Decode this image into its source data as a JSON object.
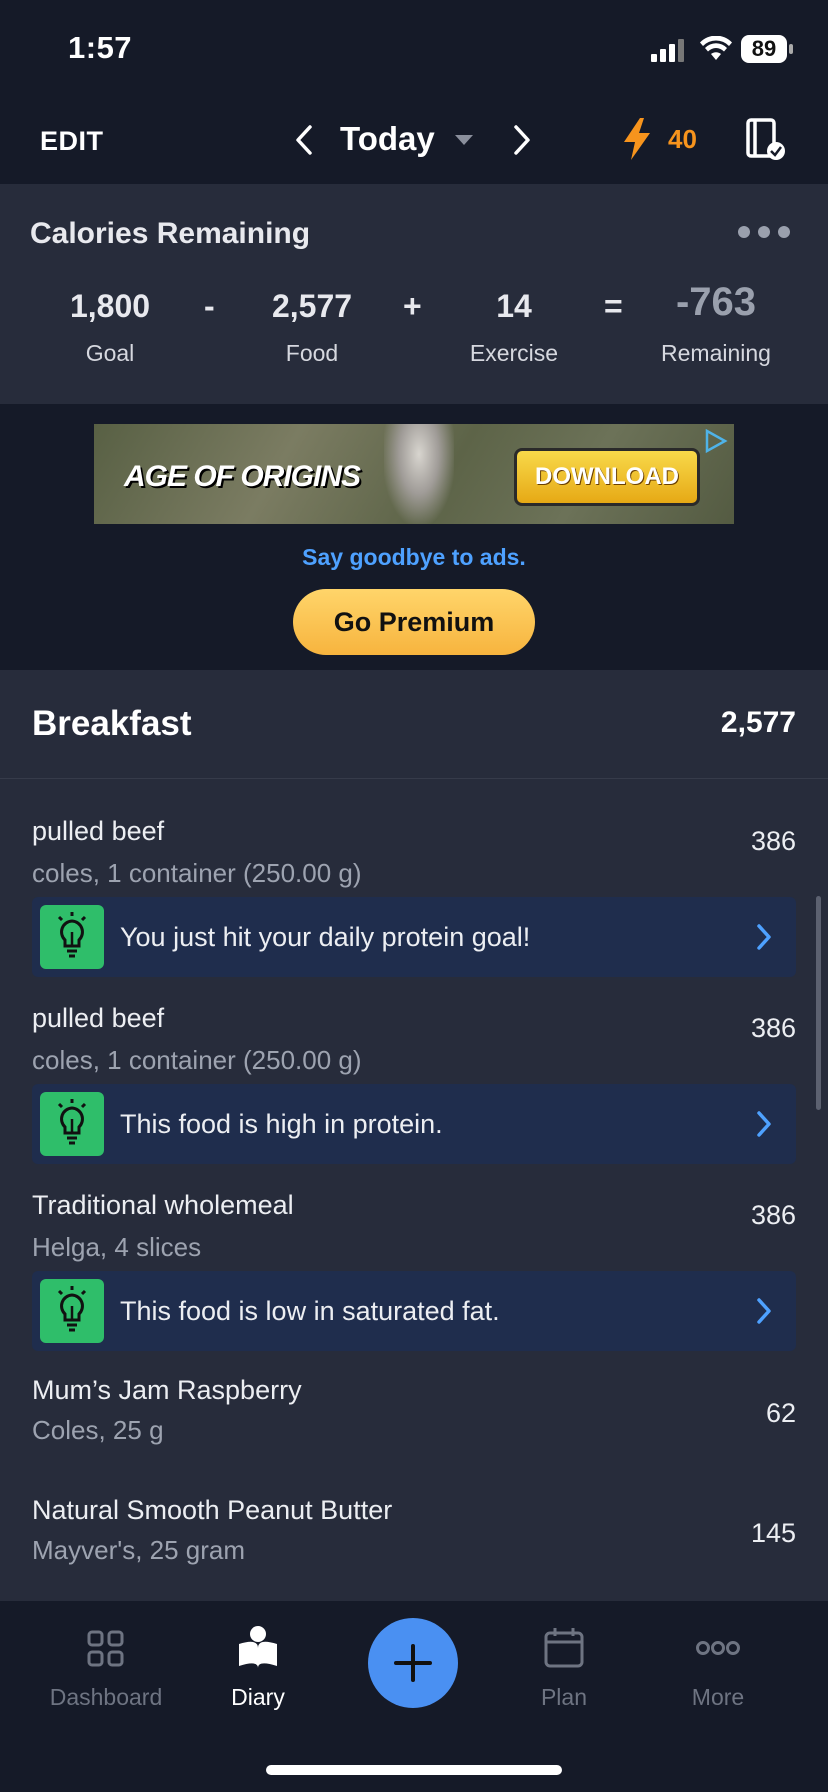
{
  "status_bar": {
    "time": "1:57",
    "battery": "89"
  },
  "header": {
    "edit_label": "EDIT",
    "date_label": "Today",
    "streak_count": "40"
  },
  "calories": {
    "title": "Calories Remaining",
    "goal": {
      "value": "1,800",
      "label": "Goal"
    },
    "food": {
      "value": "2,577",
      "label": "Food"
    },
    "exercise": {
      "value": "14",
      "label": "Exercise"
    },
    "remaining": {
      "value": "-763",
      "label": "Remaining"
    },
    "op_minus": "-",
    "op_plus": "+",
    "op_equals": "="
  },
  "ad": {
    "banner_title": "AGE OF ORIGINS",
    "banner_cta": "DOWNLOAD",
    "goodbye_text": "Say goodbye to ads.",
    "premium_label": "Go Premium"
  },
  "diary": {
    "meal_name": "Breakfast",
    "meal_total": "2,577",
    "entries": [
      {
        "name": "pulled beef",
        "desc": "coles, 1 container (250.00 g)",
        "calories": "386",
        "tip": "You just hit your daily protein goal!"
      },
      {
        "name": "pulled beef",
        "desc": "coles, 1 container (250.00 g)",
        "calories": "386",
        "tip": "This food is high in protein."
      },
      {
        "name": "Traditional wholemeal",
        "desc": "Helga, 4 slices",
        "calories": "386",
        "tip": "This food is low in saturated fat."
      },
      {
        "name": "Mum’s Jam Raspberry",
        "desc": "Coles, 25 g",
        "calories": "62"
      },
      {
        "name": "Natural Smooth Peanut Butter",
        "desc": "Mayver's, 25 gram",
        "calories": "145"
      }
    ]
  },
  "nav": {
    "dashboard": "Dashboard",
    "diary": "Diary",
    "plan": "Plan",
    "more": "More",
    "active": "Diary"
  },
  "colors": {
    "accent": "#4ea1ff",
    "streak": "#f7941d",
    "tip_icon": "#2fbe6a",
    "premium": "#ffc857"
  }
}
